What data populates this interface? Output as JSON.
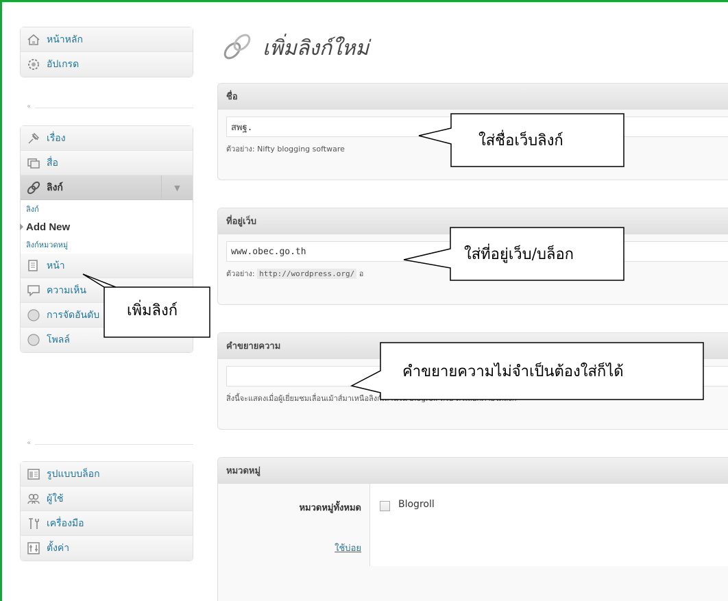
{
  "page": {
    "title": "เพิ่มลิงก์ใหม่"
  },
  "sidebar": {
    "group1": [
      {
        "label": "หน้าหลัก",
        "icon": "home-icon"
      },
      {
        "label": "อัปเกรด",
        "icon": "upgrade-icon"
      }
    ],
    "separator_glyph": "«",
    "group2": [
      {
        "label": "เรื่อง",
        "icon": "pin-icon"
      },
      {
        "label": "สื่อ",
        "icon": "media-icon"
      }
    ],
    "links_menu": {
      "label": "ลิงก์",
      "arrow": "▼",
      "sub": [
        "ลิงก์",
        "Add New",
        "ลิงก์หมวดหมู่"
      ]
    },
    "group3": [
      {
        "label": "หน้า",
        "icon": "page-icon"
      },
      {
        "label": "ความเห็น",
        "icon": "comment-icon"
      },
      {
        "label": "การจัดอันดับ",
        "icon": "rating-icon"
      },
      {
        "label": "โพลล์",
        "icon": "poll-icon"
      }
    ],
    "group4": [
      {
        "label": "รูปแบบบล็อก",
        "icon": "appearance-icon"
      },
      {
        "label": "ผู้ใช้",
        "icon": "users-icon"
      },
      {
        "label": "เครื่องมือ",
        "icon": "tools-icon"
      },
      {
        "label": "ตั้งค่า",
        "icon": "settings-icon"
      }
    ]
  },
  "form": {
    "name": {
      "heading": "ชื่อ",
      "value": "สพฐ.",
      "hint": "ตัวอย่าง: Nifty blogging software"
    },
    "url": {
      "heading": "ที่อยู่เว็บ",
      "value": "www.obec.go.th",
      "hint_prefix": "ตัวอย่าง:",
      "hint_code": "http://wordpress.org/",
      "hint_suffix": "อ"
    },
    "description": {
      "heading": "คำขยายความ",
      "value": "",
      "hint": "สิ่งนี้จะแสดงเมื่อผู้เยี่ยมชมเลื่อนเม้าส์มาเหนือลิงก์เล่านี้ใน blogroll หรือ ตัวเลือกภายใต้ลิงก์"
    },
    "categories": {
      "heading": "หมวดหมู่",
      "all_tab": "หมวดหมู่ทั้งหมด",
      "popular_tab": "ใช้บ่อย",
      "items": [
        {
          "label": "Blogroll",
          "checked": false
        }
      ]
    }
  },
  "callouts": {
    "name": "ใส่ชื่อเว็บลิงก์",
    "url": "ใส่ที่อยู่เว็บ/บล็อก",
    "description": "คำขยายความไม่จำเป็นต้องใส่ก็ได้",
    "add_new": "เพิ่มลิงก์"
  }
}
